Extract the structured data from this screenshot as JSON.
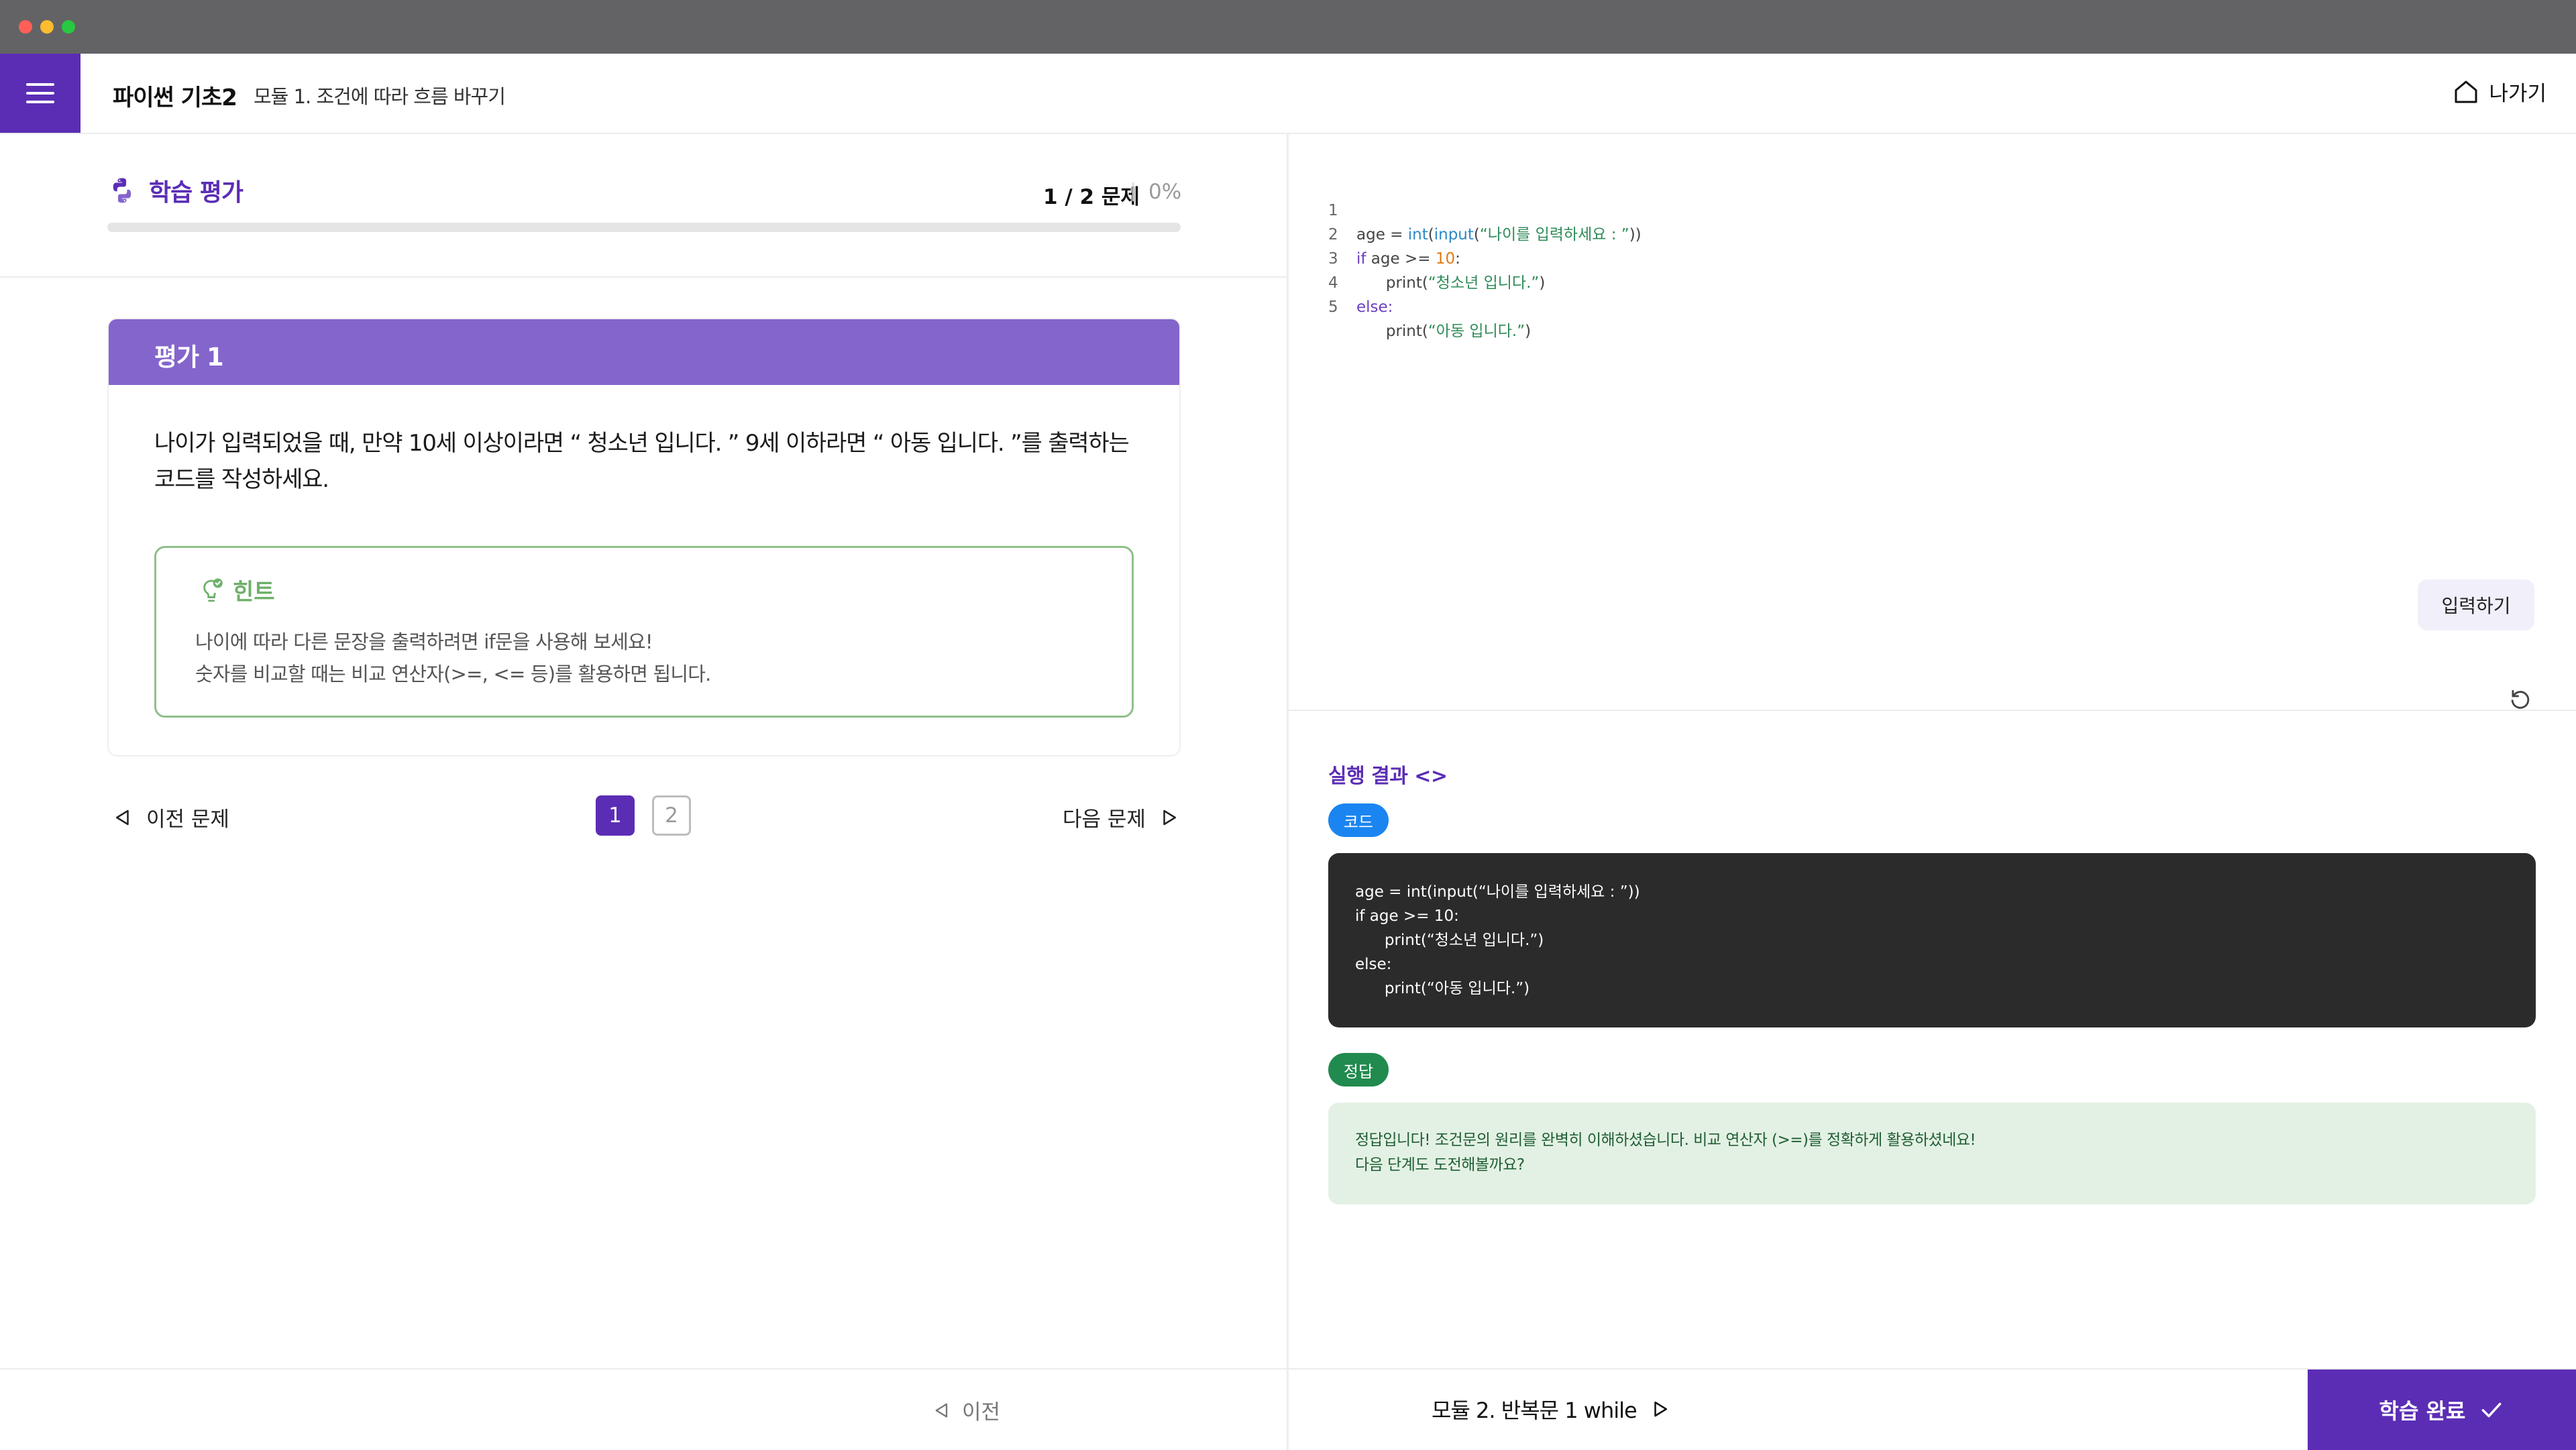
{
  "header": {
    "course_title": "파이썬 기초2",
    "module_title": "모듈 1. 조건에 따라 흐름 바꾸기",
    "exit_label": "나가기"
  },
  "assessment": {
    "title": "학습 평가",
    "counter": "1 / 2 문제",
    "percent": "0%",
    "progress": 0
  },
  "question_card": {
    "title": "평가 1",
    "question": "나이가 입력되었을 때, 만약 10세 이상이라면 “ 청소년 입니다. ” 9세 이하라면 “ 아동 입니다. ”를 출력하는 코드를 작성하세요.",
    "hint": {
      "title": "힌트",
      "lines": [
        "나이에 따라 다른 문장을 출력하려면 if문을 사용해 보세요!",
        "숫자를 비교할 때는 비교 연산자(>=, <= 등)를 활용하면 됩니다."
      ]
    }
  },
  "pagination": {
    "prev_label": "이전 문제",
    "next_label": "다음 문제",
    "pages": [
      "1",
      "2"
    ],
    "current": "1"
  },
  "editor": {
    "line_numbers": [
      "1",
      "2",
      "3",
      "4",
      "5"
    ],
    "tokens": {
      "age_assign": "age = ",
      "int_fn": "int",
      "input_fn": "input",
      "prompt_str": "“나이를 입력하세요 : ”",
      "if_kw": "if",
      "age_cmp": " age >= ",
      "ten": "10",
      "colon": ":",
      "indent_print": "      print(",
      "teen_str": "“청소년 입니다.”",
      "else_kw": "else:",
      "child_str": "“아동 입니다.”"
    },
    "input_button": "입력하기"
  },
  "result": {
    "title": "실행 결과 <>",
    "code_badge": "코드",
    "code_lines": [
      "age = int(input(“나이를 입력하세요 : ”))",
      "if age >= 10:",
      "      print(“청소년 입니다.”)",
      "else:",
      "      print(“아동 입니다.”)"
    ],
    "answer_badge": "정답",
    "answer_lines": [
      "정답입니다! 조건문의 원리를 완벽히 이해하셨습니다. 비교 연산자 (>=)를 정확하게 활용하셨네요!",
      "다음 단계도 도전해볼까요?"
    ]
  },
  "footer": {
    "prev_label": "이전",
    "next_module": "모듈 2. 반복문 1 while",
    "complete_label": "학습 완료"
  },
  "colors": {
    "brand_purple": "#5b2db5",
    "card_header": "#8465cc",
    "hint_green": "#6fb06a",
    "code_badge_blue": "#1a85f0",
    "answer_badge_green": "#218a4e"
  }
}
